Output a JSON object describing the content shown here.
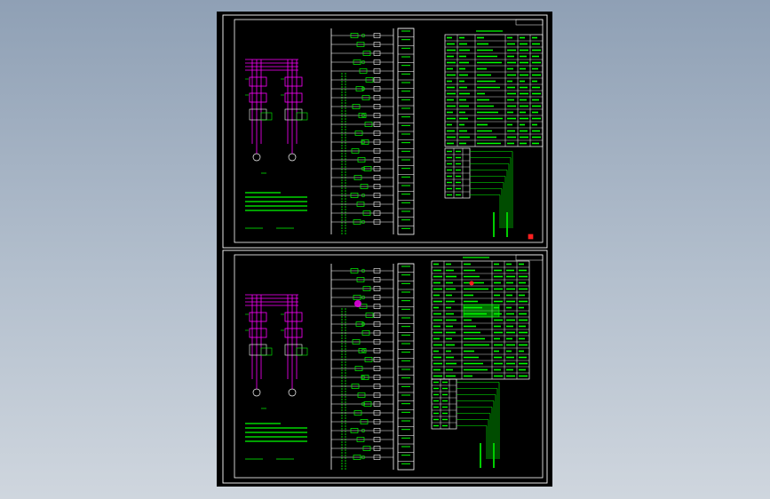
{
  "viewer": {
    "background_top": "#8fa0b5",
    "background_bottom": "#cfd6de"
  },
  "drawing": {
    "paper_color": "#000000",
    "border_color": "#ffffff",
    "power_line_color": "#ff00ff",
    "control_line_color": "#ffffff",
    "component_color": "#00ff00",
    "annotation_color": "#00ff00",
    "marker_color": "#ff2020",
    "sheets": [
      {
        "id": "upper",
        "title_strip": "",
        "motors": [
          "M1",
          "M2"
        ],
        "notes_lines": 5,
        "table_rows": 18,
        "table_cols": 6,
        "io_rows": 8
      },
      {
        "id": "lower",
        "title_strip": "",
        "motors": [
          "M1",
          "M2"
        ],
        "notes_lines": 5,
        "table_rows": 19,
        "table_cols": 6,
        "io_rows": 8
      }
    ]
  }
}
